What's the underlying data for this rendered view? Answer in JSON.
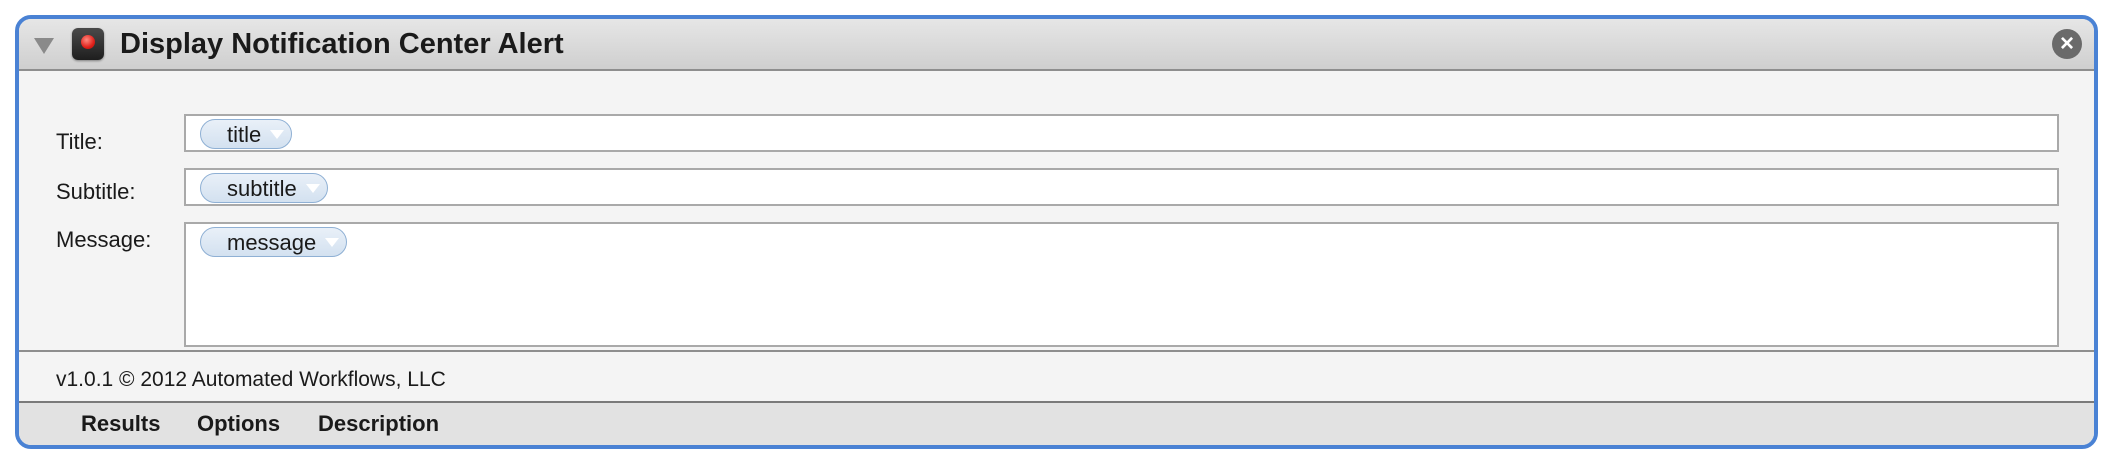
{
  "action": {
    "title": "Display Notification Center Alert",
    "app_icon": "notification-center-icon",
    "disclosure_icon": "disclosure-triangle-icon",
    "close_icon": "close-icon",
    "close_glyph": "×"
  },
  "fields": {
    "title": {
      "label": "Title:",
      "token": "title"
    },
    "subtitle": {
      "label": "Subtitle:",
      "token": "subtitle"
    },
    "message": {
      "label": "Message:",
      "token": "message"
    }
  },
  "footer": {
    "version": "v1.0.1 © 2012 Automated Workflows, LLC"
  },
  "tabs": [
    {
      "label": "Results"
    },
    {
      "label": "Options"
    },
    {
      "label": "Description"
    }
  ],
  "colors": {
    "accent_border": "#4a82d4",
    "token_fill": "#d3e1f0",
    "background": "#f4f4f4"
  }
}
